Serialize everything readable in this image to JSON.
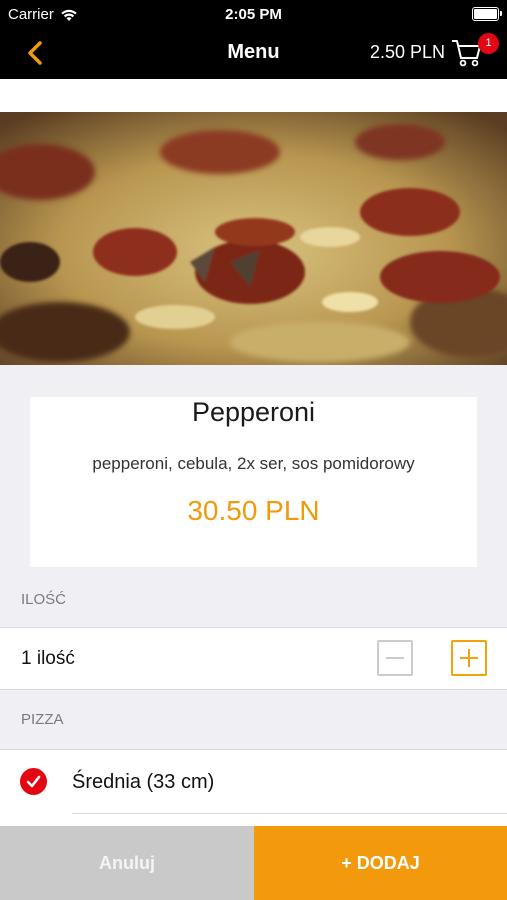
{
  "status_bar": {
    "carrier": "Carrier",
    "time": "2:05 PM"
  },
  "nav": {
    "back_icon": "chevron-left-icon",
    "title": "Menu",
    "cart_total": "2.50 PLN",
    "cart_icon": "cart-icon",
    "cart_badge": "1"
  },
  "product": {
    "name": "Pepperoni",
    "description": "pepperoni, cebula, 2x ser, sos pomidorowy",
    "price": "30.50 PLN"
  },
  "quantity_section": {
    "header": "ILOŚĆ",
    "label": "1 ilość",
    "minus_icon": "minus-icon",
    "plus_icon": "plus-icon"
  },
  "pizza_section": {
    "header": "PIZZA",
    "options": [
      {
        "label": "Średnia (33 cm)",
        "selected": true
      }
    ]
  },
  "actions": {
    "cancel_label": "Anuluj",
    "add_label": "+ DODAJ"
  },
  "colors": {
    "accent": "#f29a0b",
    "badge": "#e30613",
    "cancel_bg": "#c9c9c9"
  }
}
